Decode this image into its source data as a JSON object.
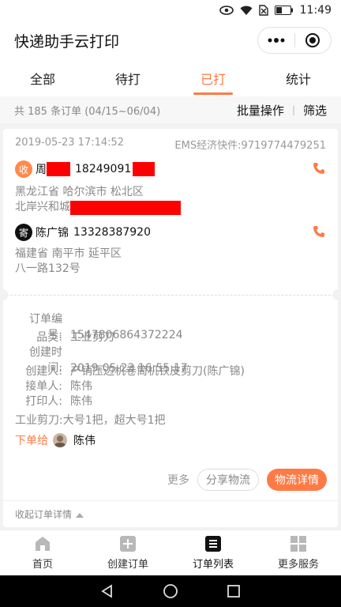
{
  "status_bar": {
    "time": "11:49"
  },
  "app": {
    "title": "快递助手云打印"
  },
  "tabs": [
    {
      "label": "全部",
      "active": false
    },
    {
      "label": "待打",
      "active": false
    },
    {
      "label": "已打",
      "active": true
    },
    {
      "label": "统计",
      "active": false
    }
  ],
  "summary": {
    "count_text": "共 185 条订单 (04/15~06/04)",
    "batch_label": "批量操作",
    "filter_label": "筛选"
  },
  "order": {
    "datetime": "2019-05-23 17:14:52",
    "courier": "EMS经济快件:9719774479251",
    "recipient": {
      "badge": "收",
      "name": "周",
      "phone": "18249091",
      "address_line1": "黑龙江省 哈尔滨市 松北区",
      "address_line2": "北岸兴和城"
    },
    "sender": {
      "badge": "寄",
      "name": "陈广锦",
      "phone": "13328387920",
      "address_line1": "福建省 南平市 延平区",
      "address_line2": "八一路132号"
    },
    "order_no_label": "订单编号:",
    "order_no": "1547806864372224",
    "category_label": "品类:",
    "category": "工业剪刀",
    "created_time_label": "创建时间:",
    "created_time": "2019-05-23 16:55:17",
    "creator_label": "创建人:",
    "creator": "产销压边机卷筒机铁皮剪刀(陈广锦)",
    "receiver_label": "接单人:",
    "receiver": "陈伟",
    "printer_label": "打印人:",
    "printer": "陈伟",
    "note": "工业剪刀:大号1把，超大号1把",
    "assign_label": "下单给",
    "assign_name": "陈伟",
    "more_label": "更多",
    "share_label": "分享物流",
    "detail_label": "物流详情",
    "collapse_label": "收起订单详情"
  },
  "bottom_nav": [
    {
      "label": "首页",
      "icon": "home-icon"
    },
    {
      "label": "创建订单",
      "icon": "plus-icon"
    },
    {
      "label": "订单列表",
      "icon": "list-icon",
      "active": true
    },
    {
      "label": "更多服务",
      "icon": "grid-icon"
    }
  ],
  "colors": {
    "accent": "#ff7a45",
    "redaction": "#ff0000"
  }
}
